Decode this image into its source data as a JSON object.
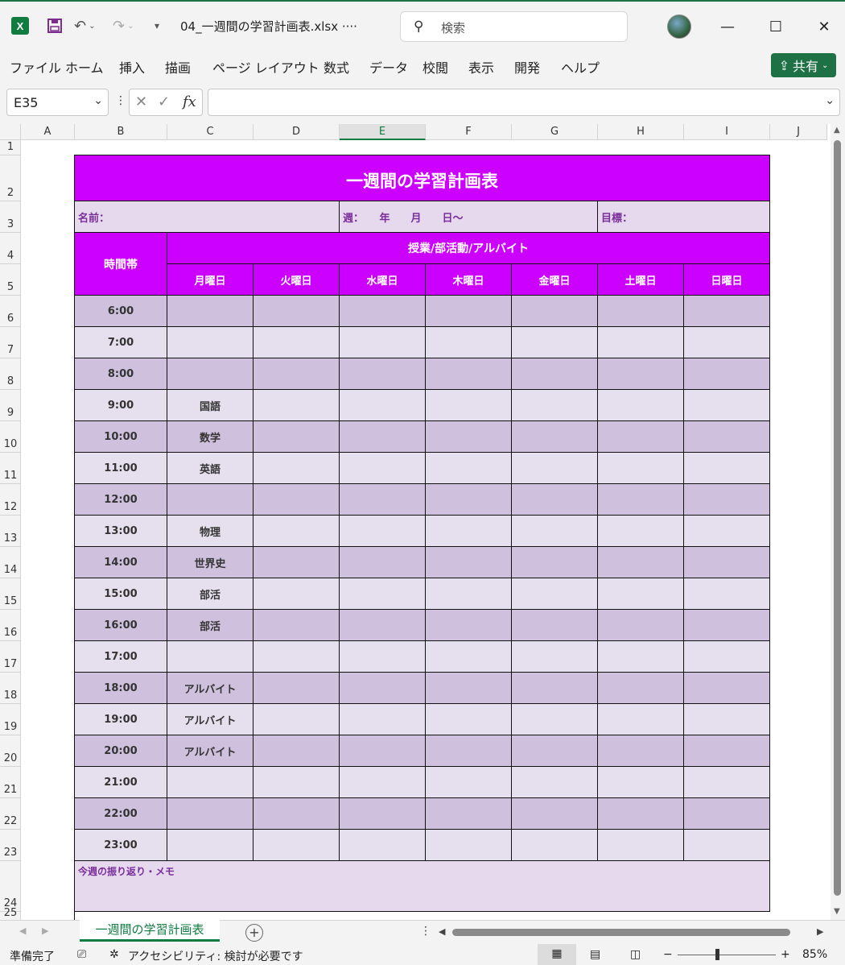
{
  "titlebar": {
    "app_logo": "X",
    "file_name": "04_一週間の学習計画表.xlsx  ····",
    "search_placeholder": "検索",
    "icons": [
      "save-icon",
      "undo-icon",
      "redo-icon",
      "customize-icon",
      "search-icon",
      "minimize-icon",
      "maximize-icon",
      "close-icon"
    ]
  },
  "menu": {
    "items": [
      "ファイル",
      "ホーム",
      "挿入",
      "描画",
      "ページ レイアウト",
      "数式",
      "データ",
      "校閲",
      "表示",
      "開発",
      "ヘルプ"
    ],
    "share_label": "共有"
  },
  "formula_bar": {
    "name_box": "E35",
    "formula_value": ""
  },
  "grid": {
    "columns": [
      "A",
      "B",
      "C",
      "D",
      "E",
      "F",
      "G",
      "H",
      "I",
      "J"
    ],
    "selected_column": "E",
    "rows": [
      "1",
      "2",
      "3",
      "4",
      "5",
      "6",
      "7",
      "8",
      "9",
      "10",
      "11",
      "12",
      "13",
      "14",
      "15",
      "16",
      "17",
      "18",
      "19",
      "20",
      "21",
      "22",
      "23",
      "24",
      "25"
    ]
  },
  "sheet": {
    "title": "一週間の学習計画表",
    "name_label": "名前：",
    "week_label": "週：　　年　　月　　日～",
    "goal_label": "目標：",
    "time_header": "時間帯",
    "activity_header": "授業/部活動/アルバイト",
    "days": [
      "月曜日",
      "火曜日",
      "水曜日",
      "木曜日",
      "金曜日",
      "土曜日",
      "日曜日"
    ],
    "times": [
      "6:00",
      "7:00",
      "8:00",
      "9:00",
      "10:00",
      "11:00",
      "12:00",
      "13:00",
      "14:00",
      "15:00",
      "16:00",
      "17:00",
      "18:00",
      "19:00",
      "20:00",
      "21:00",
      "22:00",
      "23:00"
    ],
    "monday": [
      "",
      "",
      "",
      "国語",
      "数学",
      "英語",
      "",
      "物理",
      "世界史",
      "部活",
      "部活",
      "",
      "アルバイト",
      "アルバイト",
      "アルバイト",
      "",
      "",
      ""
    ],
    "memo_label": "今週の振り返り・メモ"
  },
  "tabs": {
    "sheet_tab": "一週間の学習計画表",
    "add_sheet": "+"
  },
  "status": {
    "ready": "準備完了",
    "accessibility": "アクセシビリティ: 検討が必要です",
    "zoom": "85%"
  }
}
